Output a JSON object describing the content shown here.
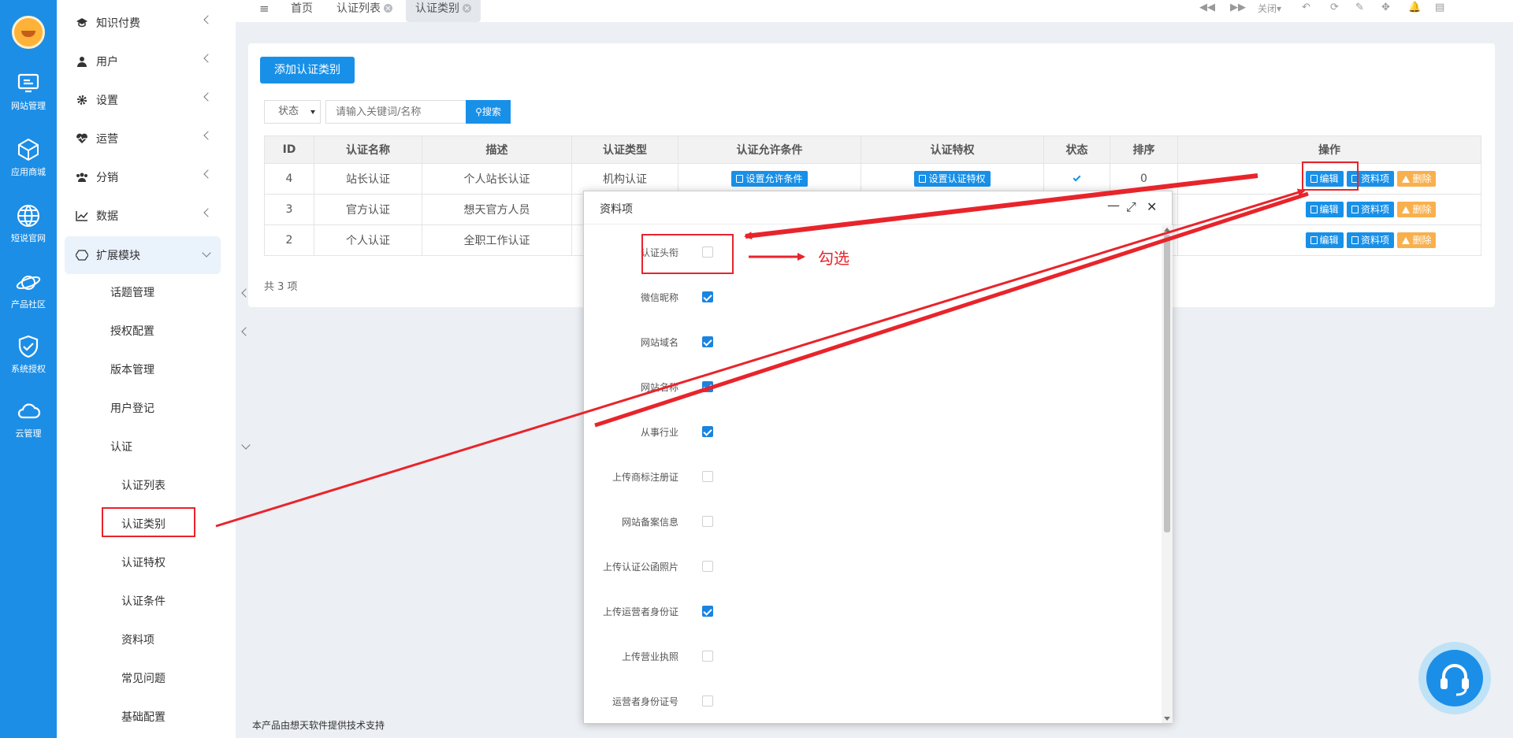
{
  "rail": {
    "items": [
      {
        "label": "网站管理",
        "icon": "monitor-icon"
      },
      {
        "label": "应用商城",
        "icon": "cube-icon"
      },
      {
        "label": "短说官网",
        "icon": "globe-icon"
      },
      {
        "label": "产品社区",
        "icon": "planet-icon"
      },
      {
        "label": "系统授权",
        "icon": "shield-check-icon"
      },
      {
        "label": "云管理",
        "icon": "cloud-icon"
      }
    ]
  },
  "menu": {
    "items": [
      {
        "label": "知识付费",
        "icon": "graduation-cap-icon"
      },
      {
        "label": "用户",
        "icon": "user-icon"
      },
      {
        "label": "设置",
        "icon": "gear-icon"
      },
      {
        "label": "运营",
        "icon": "heartbeat-icon"
      },
      {
        "label": "分销",
        "icon": "users-icon"
      },
      {
        "label": "数据",
        "icon": "line-chart-icon"
      },
      {
        "label": "扩展模块",
        "icon": "hexagon-icon"
      }
    ],
    "sub": [
      {
        "label": "话题管理"
      },
      {
        "label": "授权配置"
      },
      {
        "label": "版本管理"
      },
      {
        "label": "用户登记"
      },
      {
        "label": "认证"
      }
    ],
    "subsub": [
      {
        "label": "认证列表"
      },
      {
        "label": "认证类别"
      },
      {
        "label": "认证特权"
      },
      {
        "label": "认证条件"
      },
      {
        "label": "资料项"
      },
      {
        "label": "常见问题"
      },
      {
        "label": "基础配置"
      }
    ]
  },
  "tabs": {
    "home": "首页",
    "list": "认证列表",
    "category": "认证类别",
    "close_label": "关闭"
  },
  "toolbar": {
    "add_label": "添加认证类别",
    "status_select": "状态",
    "search_placeholder": "请输入关键词/名称",
    "search_label": "搜索"
  },
  "table": {
    "headers": [
      "ID",
      "认证名称",
      "描述",
      "认证类型",
      "认证允许条件",
      "认证特权",
      "状态",
      "排序",
      "操作"
    ],
    "rows": [
      {
        "id": "4",
        "name": "站长认证",
        "desc": "个人站长认证",
        "type": "机构认证",
        "cond_btn": "设置允许条件",
        "priv_btn": "设置认证特权",
        "sort": "0"
      },
      {
        "id": "3",
        "name": "官方认证",
        "desc": "想天官方人员",
        "type": "",
        "cond_btn": "",
        "priv_btn": "",
        "sort": ""
      },
      {
        "id": "2",
        "name": "个人认证",
        "desc": "全职工作认证",
        "type": "",
        "cond_btn": "",
        "priv_btn": "",
        "sort": ""
      }
    ],
    "action_edit": "编辑",
    "action_items": "资料项",
    "action_delete": "删除",
    "total": "共 3 项"
  },
  "modal": {
    "title": "资料项",
    "fields": [
      {
        "label": "认证头衔",
        "checked": false
      },
      {
        "label": "微信昵称",
        "checked": true
      },
      {
        "label": "网站域名",
        "checked": true
      },
      {
        "label": "网站名称",
        "checked": true
      },
      {
        "label": "从事行业",
        "checked": true
      },
      {
        "label": "上传商标注册证",
        "checked": false
      },
      {
        "label": "网站备案信息",
        "checked": false
      },
      {
        "label": "上传认证公函照片",
        "checked": false
      },
      {
        "label": "上传运营者身份证",
        "checked": true
      },
      {
        "label": "上传营业执照",
        "checked": false
      },
      {
        "label": "运营者身份证号",
        "checked": false
      }
    ]
  },
  "annotation": {
    "text": "勾选",
    "color": "#e8242b"
  },
  "footer": "本产品由想天软件提供技术支持",
  "colors": {
    "primary": "#1890e8",
    "warn": "#f8b04e",
    "rail": "#1d8ee6"
  }
}
